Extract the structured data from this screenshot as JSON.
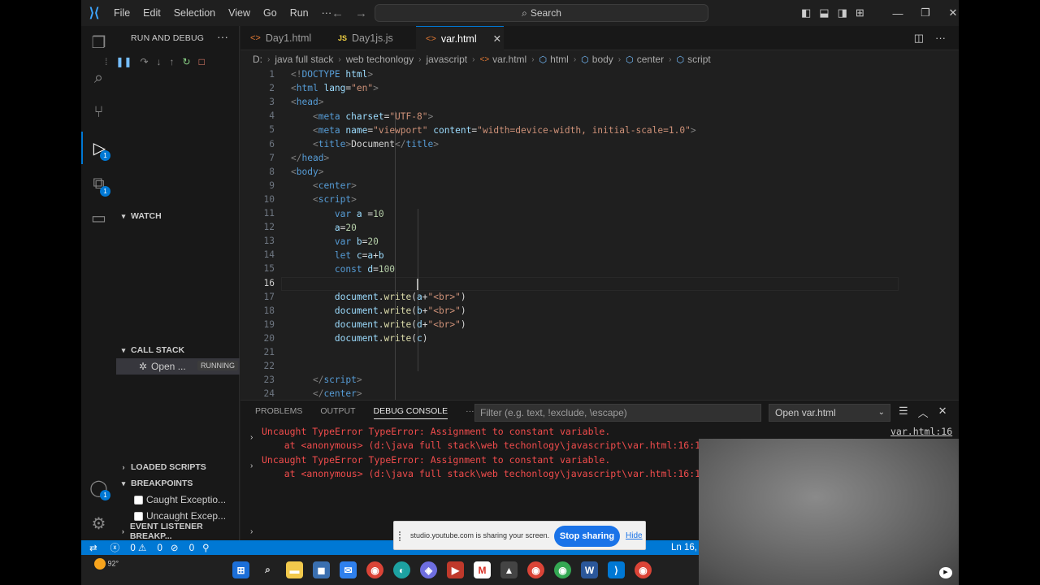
{
  "menu": [
    "File",
    "Edit",
    "Selection",
    "View",
    "Go",
    "Run",
    "···"
  ],
  "search": {
    "label": "Search"
  },
  "activity_badges": {
    "run": "1",
    "extensions": "1",
    "accounts": "1"
  },
  "sidebar": {
    "title": "RUN AND DEBUG",
    "more": "···",
    "watch": "WATCH",
    "call_stack": "CALL STACK",
    "call_stack_item": "Open ...",
    "call_stack_state": "RUNNING",
    "loaded_scripts": "LOADED SCRIPTS",
    "breakpoints": "BREAKPOINTS",
    "bp_caught": "Caught Exceptio...",
    "bp_uncaught": "Uncaught Excep...",
    "event_listener": "EVENT LISTENER BREAKP..."
  },
  "tabs": [
    {
      "label": "Day1.html"
    },
    {
      "label": "Day1js.js"
    },
    {
      "label": "var.html"
    }
  ],
  "breadcrumb": [
    "D:",
    "java full stack",
    "web techonlogy",
    "javascript",
    "var.html",
    "html",
    "body",
    "center",
    "script"
  ],
  "editor": {
    "line_numbers": [
      "1",
      "2",
      "3",
      "4",
      "5",
      "6",
      "7",
      "8",
      "9",
      "10",
      "11",
      "12",
      "13",
      "14",
      "15",
      "16",
      "17",
      "18",
      "19",
      "20",
      "21",
      "22",
      "23",
      "24"
    ],
    "current_line": 16
  },
  "panel": {
    "tabs": [
      "PROBLEMS",
      "OUTPUT",
      "DEBUG CONSOLE"
    ],
    "more": "···",
    "filter_placeholder": "Filter (e.g. text, !exclude, \\escape)",
    "select": "Open var.html",
    "source_link": "var.html:16",
    "errors": [
      {
        "line1": "Uncaught TypeError TypeError: Assignment to constant variable.",
        "line2": "    at <anonymous> (d:\\java full stack\\web techonlogy\\javascript\\var.html:16:1"
      },
      {
        "line1": "Uncaught TypeError TypeError: Assignment to constant variable.",
        "line2": "    at <anonymous> (d:\\java full stack\\web techonlogy\\javascript\\var.html:16:1"
      }
    ]
  },
  "status": {
    "errors": "0",
    "warnings": "0",
    "ports": "0",
    "position": "Ln 16, Co"
  },
  "share": {
    "message": "studio.youtube.com is sharing your screen.",
    "stop": "Stop sharing",
    "hide": "Hide"
  },
  "taskbar": {
    "temp": "92°"
  }
}
